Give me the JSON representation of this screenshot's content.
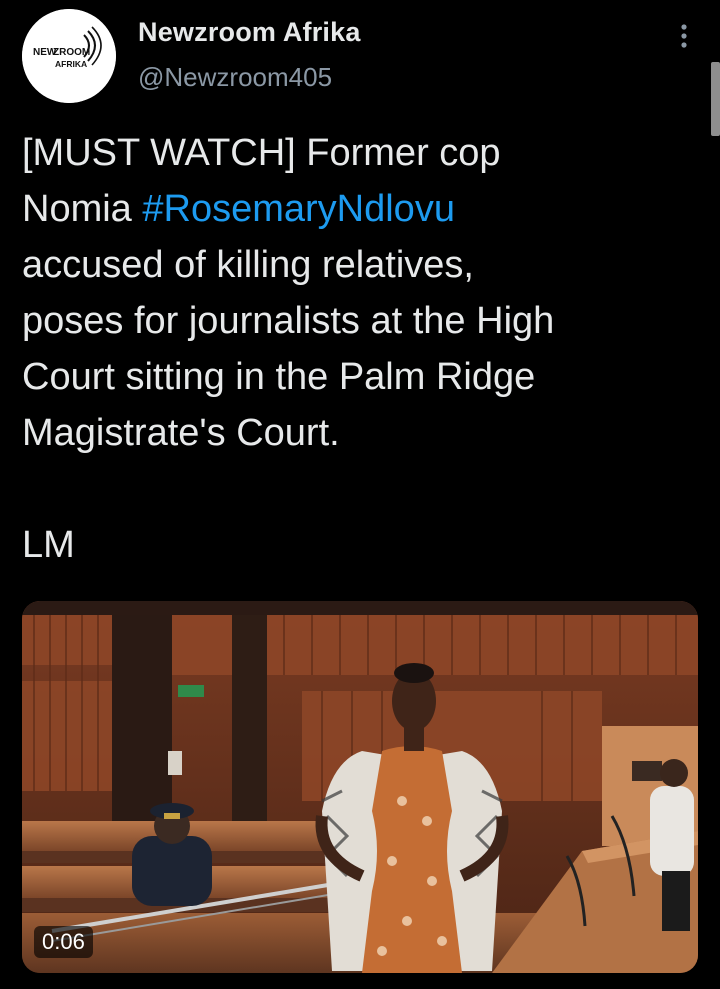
{
  "author": {
    "display_name": "Newzroom Afrika",
    "handle": "@Newzroom405",
    "avatar_logo_text_top": "NEWZROOM",
    "avatar_logo_text_bottom": "AFRIKA"
  },
  "tweet": {
    "lines": [
      {
        "text": "[MUST WATCH]  Former cop"
      },
      {
        "prefix": "Nomia ",
        "hashtag": "#RosemaryNdlovu"
      },
      {
        "text": "accused of killing relatives,"
      },
      {
        "text": "poses for journalists at the High"
      },
      {
        "text": "Court sitting in the Palm Ridge"
      },
      {
        "text": "Magistrate's Court."
      }
    ],
    "signoff": "LM"
  },
  "media": {
    "type": "video",
    "duration": "0:06",
    "icon": "video-thumbnail"
  },
  "colors": {
    "background": "#000000",
    "text": "#e7e9ea",
    "secondary": "#8b98a5",
    "link": "#1d9bf0"
  },
  "icons": {
    "more": "more-vertical-icon"
  }
}
